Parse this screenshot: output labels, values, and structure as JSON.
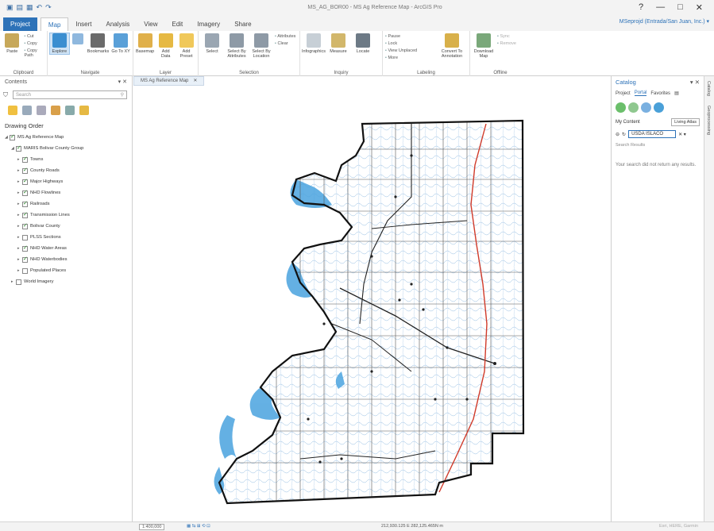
{
  "window": {
    "title": "MS_AG_BOR00 - MS Ag Reference Map - ArcGIS Pro",
    "controls": [
      "?",
      "—",
      "□",
      "✕"
    ]
  },
  "qat_icons": [
    "new-icon",
    "open-icon",
    "save-icon",
    "undo-icon",
    "redo-icon"
  ],
  "tabs": {
    "project": "Project",
    "items": [
      "Map",
      "Insert",
      "Analysis",
      "View",
      "Edit",
      "Imagery",
      "Share"
    ],
    "active": "Map"
  },
  "user": "MSeprojd (Entrada/San Juan, Inc.) ▾",
  "ribbon": {
    "clipboard": {
      "label": "Clipboard",
      "paste": "Paste",
      "items": [
        "Cut",
        "Copy",
        "Copy Path"
      ]
    },
    "navigate": {
      "label": "Navigate",
      "explore": "Explore",
      "bookmarks": "Bookmarks",
      "goto": "Go To XY"
    },
    "layer": {
      "label": "Layer",
      "basemap": "Basemap",
      "add_data": "Add Data",
      "add_preset": "Add Preset"
    },
    "selection": {
      "label": "Selection",
      "select": "Select",
      "by_attributes": "Select By Attributes",
      "by_location": "Select By Location",
      "attributes": "Attributes",
      "clear": "Clear"
    },
    "inquiry": {
      "label": "Inquiry",
      "infographics": "Infographics",
      "measure": "Measure",
      "locate": "Locate"
    },
    "labeling": {
      "label": "Labeling",
      "pause": "Pause",
      "lock": "Lock",
      "view_unplaced": "View Unplaced",
      "more": "More",
      "convert": "Convert To Annotation"
    },
    "offline": {
      "label": "Offline",
      "download": "Download Map",
      "sync": "Sync",
      "remove": "Remove"
    }
  },
  "contents": {
    "title": "Contents",
    "search_placeholder": "Search",
    "drawing_order": "Drawing Order",
    "layers": [
      {
        "name": "MS Ag Reference Map",
        "indent": 0,
        "checked": true,
        "expanded": true
      },
      {
        "name": "MARIS Bolivar County Group",
        "indent": 1,
        "checked": true,
        "expanded": true
      },
      {
        "name": "Towns",
        "indent": 2,
        "checked": true
      },
      {
        "name": "County Roads",
        "indent": 2,
        "checked": true
      },
      {
        "name": "Major Highways",
        "indent": 2,
        "checked": true
      },
      {
        "name": "NHD Flowlines",
        "indent": 2,
        "checked": true
      },
      {
        "name": "Railroads",
        "indent": 2,
        "checked": true
      },
      {
        "name": "Transmission Lines",
        "indent": 2,
        "checked": true
      },
      {
        "name": "Bolivar County",
        "indent": 2,
        "checked": true
      },
      {
        "name": "PLSS Sections",
        "indent": 2,
        "checked": false
      },
      {
        "name": "NHD Water Areas",
        "indent": 2,
        "checked": true
      },
      {
        "name": "NHD Waterbodies",
        "indent": 2,
        "checked": true
      },
      {
        "name": "Populated Places",
        "indent": 2,
        "checked": false
      },
      {
        "name": "World Imagery",
        "indent": 1,
        "checked": false
      }
    ]
  },
  "map": {
    "tab_label": "MS Ag Reference Map",
    "colors": {
      "water": "#4aa3df",
      "boundary": "#111111",
      "highway": "#d03a2a",
      "stream": "#6fa8dc"
    }
  },
  "catalog": {
    "title": "Catalog",
    "tabs": [
      "Project",
      "Portal",
      "Favorites"
    ],
    "active_tab": "Portal",
    "my_content": "My Content",
    "living_atlas": "Living Atlas",
    "search_value": "USDA ISLACO",
    "search_results_label": "Search Results",
    "no_results": "Your search did not return any results."
  },
  "side_tabs": [
    "Catalog",
    "Geoprocessing"
  ],
  "status": {
    "scale": "1:400,000",
    "coords": "212,930.125 E 282,125.465N m",
    "rendering": "Esri, HERE, Garmin"
  }
}
